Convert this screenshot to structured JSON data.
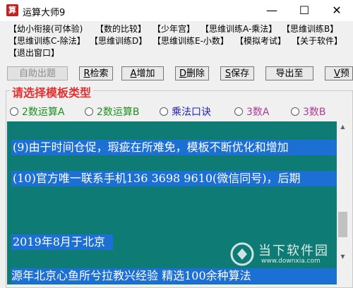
{
  "window": {
    "title": "运算大师9",
    "app_icon_glyph": "算",
    "minimize": "—",
    "maximize": "☐",
    "close": "✕"
  },
  "menu": {
    "items": [
      "【幼小衔接(可体验)",
      "【数的比较】",
      "【少年宫】",
      "【思维训练A-乘法】",
      "【思维训练B】",
      "【思维训练C-除法】",
      "【思维训练D】",
      "【思维训练E-小数】",
      "【模拟考试】",
      "【关于软件】",
      "【退出窗口】"
    ]
  },
  "toolbar": {
    "auto": "自助出题",
    "retrieve_key": "R",
    "retrieve": "检索",
    "add_key": "A",
    "add": "增加",
    "delete_key": "D",
    "delete": "删除",
    "save_key": "S",
    "save": "保存",
    "export": "导出至",
    "preview_key": "V",
    "preview": "预"
  },
  "template_group": {
    "title": "请选择模板类型",
    "options": [
      {
        "label": "2数运算A",
        "color": "#1f8f1f"
      },
      {
        "label": "2数运算B",
        "color": "#1f8f1f"
      },
      {
        "label": "乘法口诀",
        "color": "#2323b8"
      },
      {
        "label": "3数A",
        "color": "#b03a9a"
      },
      {
        "label": "3数B",
        "color": "#b03a9a"
      }
    ]
  },
  "content": {
    "line1": "(9)由于时间仓促，瑕疵在所难免，模板不断优化和增加",
    "line2": "(10)官方唯一联系手机136 3698 9610(微信同号)，后期",
    "line3": "2019年8月于北京",
    "partial": "源年北京心鱼所兮拉教兴经验  精选100余种算法"
  },
  "watermark": {
    "name": "当下软件园",
    "url": "www.downxia.com"
  },
  "colors": {
    "textarea_bg": "#0e7b74",
    "selection": "#1c6fd3",
    "group_title": "#e03030"
  }
}
